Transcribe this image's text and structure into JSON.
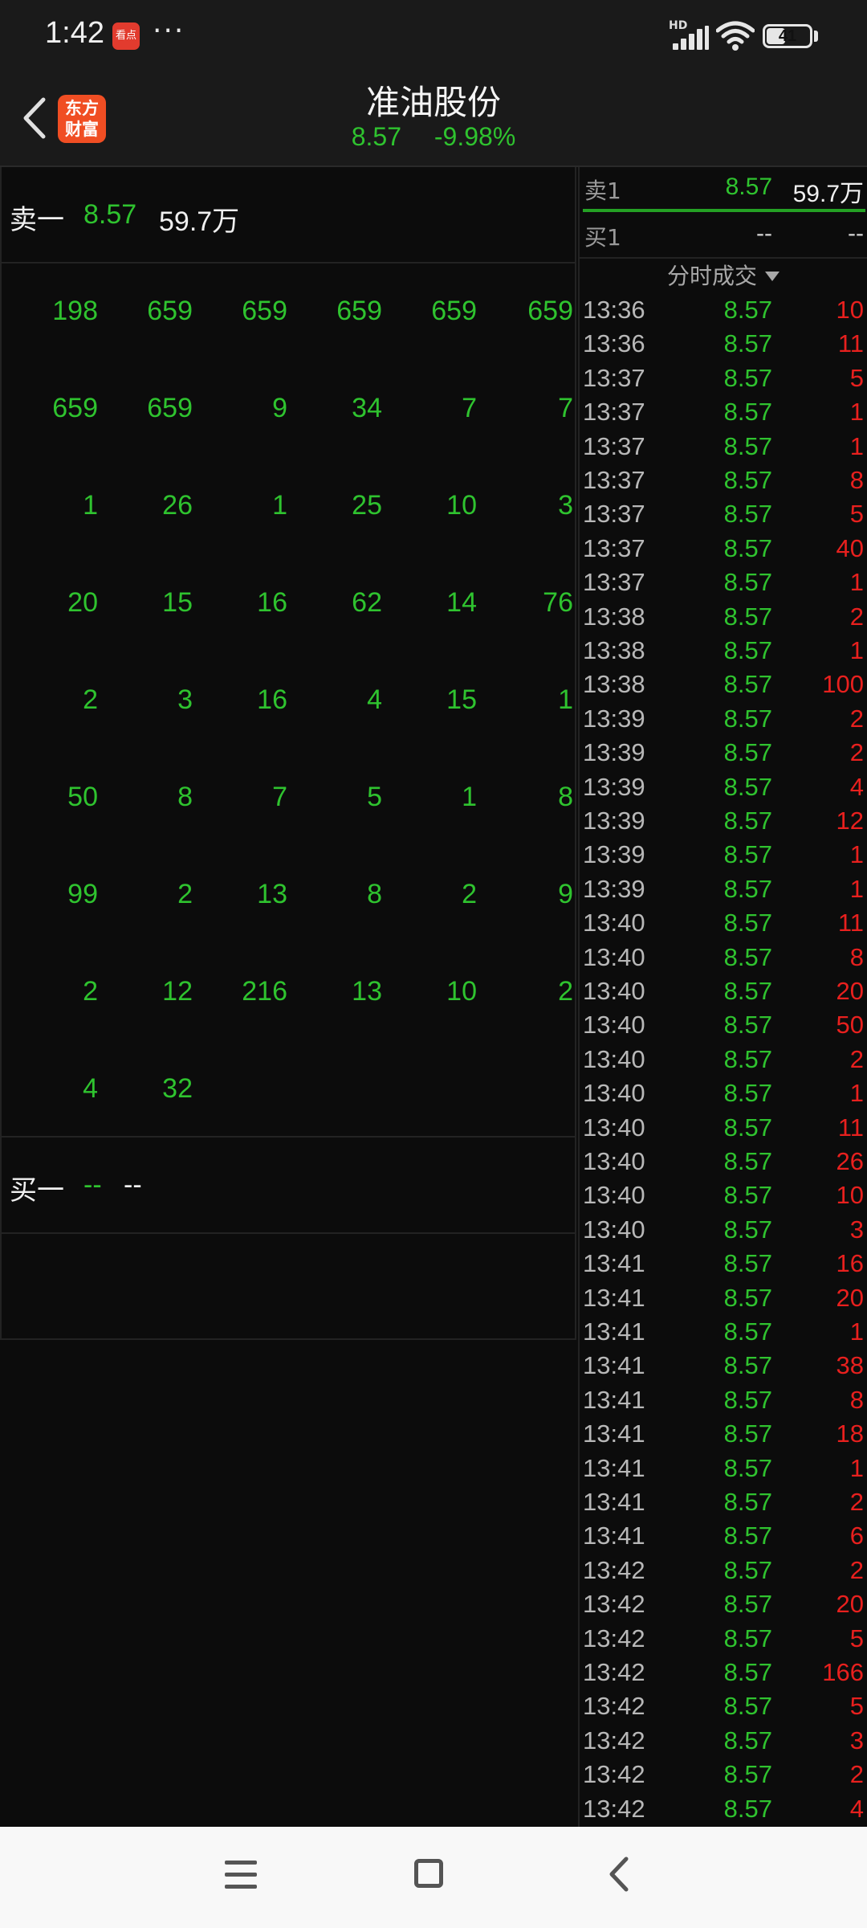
{
  "status_bar": {
    "time": "1:42",
    "app_badge": "看点",
    "more": "···",
    "network": "HD",
    "battery": "41"
  },
  "header": {
    "app_logo": "东方\n财富",
    "stock_name": "准油股份",
    "price": "8.57",
    "change_pct": "-9.98%"
  },
  "sell_level": {
    "label": "卖一",
    "price": "8.57",
    "volume": "59.7万"
  },
  "buy_level": {
    "label": "买一",
    "price": "--",
    "volume": "--"
  },
  "queue_grid": [
    [
      "198",
      "659",
      "659",
      "659",
      "659",
      "659"
    ],
    [
      "659",
      "659",
      "9",
      "34",
      "7",
      "7"
    ],
    [
      "1",
      "26",
      "1",
      "25",
      "10",
      "3"
    ],
    [
      "20",
      "15",
      "16",
      "62",
      "14",
      "76"
    ],
    [
      "2",
      "3",
      "16",
      "4",
      "15",
      "1"
    ],
    [
      "50",
      "8",
      "7",
      "5",
      "1",
      "8"
    ],
    [
      "99",
      "2",
      "13",
      "8",
      "2",
      "9"
    ],
    [
      "2",
      "12",
      "216",
      "13",
      "10",
      "2"
    ],
    [
      "4",
      "32"
    ]
  ],
  "order_book": [
    {
      "label": "卖1",
      "price": "8.57",
      "volume": "59.7万"
    },
    {
      "label": "买1",
      "price": "--",
      "volume": "--"
    }
  ],
  "ticks_title": "分时成交",
  "ticks": [
    {
      "time": "13:36",
      "price": "8.57",
      "volume": "10"
    },
    {
      "time": "13:36",
      "price": "8.57",
      "volume": "11"
    },
    {
      "time": "13:37",
      "price": "8.57",
      "volume": "5"
    },
    {
      "time": "13:37",
      "price": "8.57",
      "volume": "1"
    },
    {
      "time": "13:37",
      "price": "8.57",
      "volume": "1"
    },
    {
      "time": "13:37",
      "price": "8.57",
      "volume": "8"
    },
    {
      "time": "13:37",
      "price": "8.57",
      "volume": "5"
    },
    {
      "time": "13:37",
      "price": "8.57",
      "volume": "40"
    },
    {
      "time": "13:37",
      "price": "8.57",
      "volume": "1"
    },
    {
      "time": "13:38",
      "price": "8.57",
      "volume": "2"
    },
    {
      "time": "13:38",
      "price": "8.57",
      "volume": "1"
    },
    {
      "time": "13:38",
      "price": "8.57",
      "volume": "100"
    },
    {
      "time": "13:39",
      "price": "8.57",
      "volume": "2"
    },
    {
      "time": "13:39",
      "price": "8.57",
      "volume": "2"
    },
    {
      "time": "13:39",
      "price": "8.57",
      "volume": "4"
    },
    {
      "time": "13:39",
      "price": "8.57",
      "volume": "12"
    },
    {
      "time": "13:39",
      "price": "8.57",
      "volume": "1"
    },
    {
      "time": "13:39",
      "price": "8.57",
      "volume": "1"
    },
    {
      "time": "13:40",
      "price": "8.57",
      "volume": "11"
    },
    {
      "time": "13:40",
      "price": "8.57",
      "volume": "8"
    },
    {
      "time": "13:40",
      "price": "8.57",
      "volume": "20"
    },
    {
      "time": "13:40",
      "price": "8.57",
      "volume": "50"
    },
    {
      "time": "13:40",
      "price": "8.57",
      "volume": "2"
    },
    {
      "time": "13:40",
      "price": "8.57",
      "volume": "1"
    },
    {
      "time": "13:40",
      "price": "8.57",
      "volume": "11"
    },
    {
      "time": "13:40",
      "price": "8.57",
      "volume": "26"
    },
    {
      "time": "13:40",
      "price": "8.57",
      "volume": "10"
    },
    {
      "time": "13:40",
      "price": "8.57",
      "volume": "3"
    },
    {
      "time": "13:41",
      "price": "8.57",
      "volume": "16"
    },
    {
      "time": "13:41",
      "price": "8.57",
      "volume": "20"
    },
    {
      "time": "13:41",
      "price": "8.57",
      "volume": "1"
    },
    {
      "time": "13:41",
      "price": "8.57",
      "volume": "38"
    },
    {
      "time": "13:41",
      "price": "8.57",
      "volume": "8"
    },
    {
      "time": "13:41",
      "price": "8.57",
      "volume": "18"
    },
    {
      "time": "13:41",
      "price": "8.57",
      "volume": "1"
    },
    {
      "time": "13:41",
      "price": "8.57",
      "volume": "2"
    },
    {
      "time": "13:41",
      "price": "8.57",
      "volume": "6"
    },
    {
      "time": "13:42",
      "price": "8.57",
      "volume": "2"
    },
    {
      "time": "13:42",
      "price": "8.57",
      "volume": "20"
    },
    {
      "time": "13:42",
      "price": "8.57",
      "volume": "5"
    },
    {
      "time": "13:42",
      "price": "8.57",
      "volume": "166"
    },
    {
      "time": "13:42",
      "price": "8.57",
      "volume": "5"
    },
    {
      "time": "13:42",
      "price": "8.57",
      "volume": "3"
    },
    {
      "time": "13:42",
      "price": "8.57",
      "volume": "2"
    },
    {
      "time": "13:42",
      "price": "8.57",
      "volume": "4"
    }
  ],
  "colors": {
    "down_green": "#2fc32f",
    "buy_red": "#e8201e",
    "background": "#0c0c0c",
    "panel": "#1a1a1a"
  },
  "icons": {
    "back": "chevron-left-icon",
    "menu": "menu-icon",
    "home": "home-icon",
    "nav_back": "back-icon",
    "signal": "signal-icon",
    "wifi": "wifi-icon",
    "battery": "battery-icon"
  }
}
